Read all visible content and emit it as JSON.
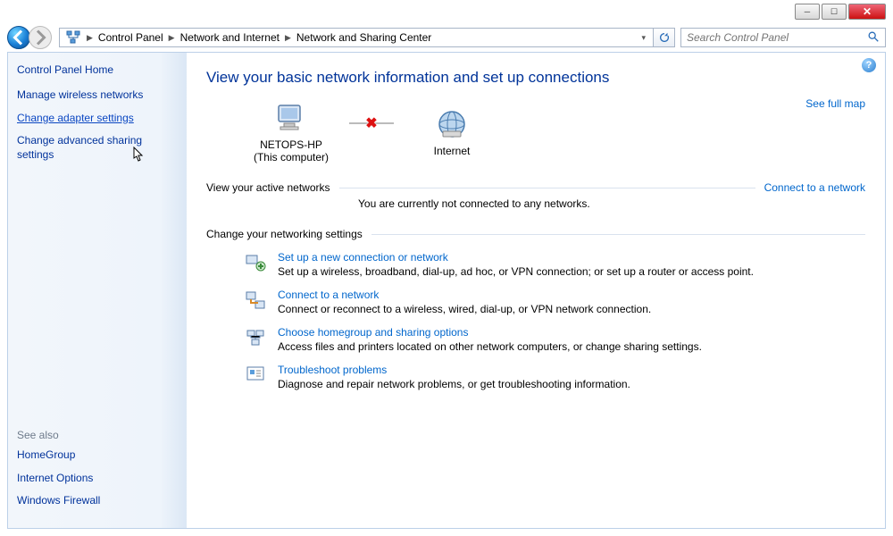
{
  "chrome": {
    "min": "─",
    "max": "☐",
    "close": "✕"
  },
  "breadcrumbs": [
    "Control Panel",
    "Network and Internet",
    "Network and Sharing Center"
  ],
  "search": {
    "placeholder": "Search Control Panel"
  },
  "sidebar": {
    "home": "Control Panel Home",
    "links": [
      "Manage wireless networks",
      "Change adapter settings",
      "Change advanced sharing settings"
    ],
    "see_also_hd": "See also",
    "see_also": [
      "HomeGroup",
      "Internet Options",
      "Windows Firewall"
    ]
  },
  "main": {
    "title": "View your basic network information and set up connections",
    "fullmap": "See full map",
    "map": {
      "pc_name": "NETOPS-HP",
      "pc_sub": "(This computer)",
      "internet": "Internet"
    },
    "active_hd": "View your active networks",
    "connect": "Connect to a network",
    "not_connected": "You are currently not connected to any networks.",
    "change_hd": "Change your networking settings",
    "opts": [
      {
        "title": "Set up a new connection or network",
        "desc": "Set up a wireless, broadband, dial-up, ad hoc, or VPN connection; or set up a router or access point."
      },
      {
        "title": "Connect to a network",
        "desc": "Connect or reconnect to a wireless, wired, dial-up, or VPN network connection."
      },
      {
        "title": "Choose homegroup and sharing options",
        "desc": "Access files and printers located on other network computers, or change sharing settings."
      },
      {
        "title": "Troubleshoot problems",
        "desc": "Diagnose and repair network problems, or get troubleshooting information."
      }
    ]
  }
}
